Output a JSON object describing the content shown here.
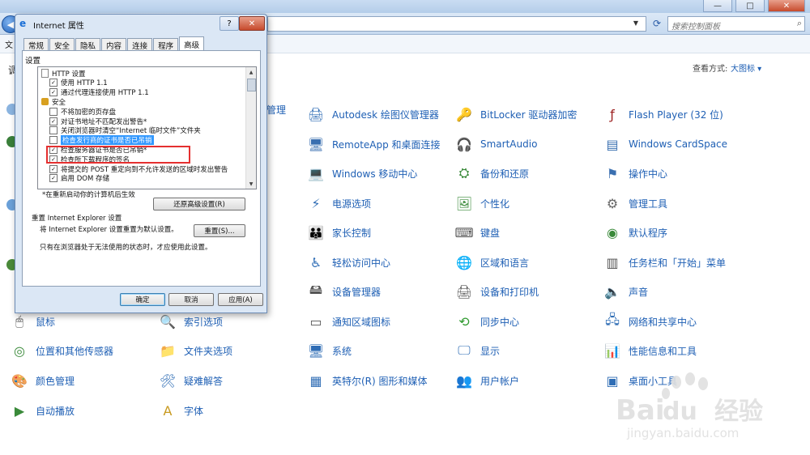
{
  "window": {
    "min": "—",
    "max": "□",
    "close": "✕",
    "menu_fragment": "文",
    "left_fragment": "调",
    "search_placeholder": "搜索控制面板",
    "view_by_label": "查看方式:",
    "view_by_value": "大图标 ▾",
    "partial_item": "管理"
  },
  "items": [
    {
      "label": "Autodesk 绘图仪管理器",
      "icon": "plotter-icon"
    },
    {
      "label": "BitLocker 驱动器加密",
      "icon": "bitlocker-icon"
    },
    {
      "label": "Flash Player (32 位)",
      "icon": "flash-icon"
    },
    {
      "label": "RemoteApp 和桌面连接",
      "icon": "remoteapp-icon"
    },
    {
      "label": "SmartAudio",
      "icon": "headphones-icon"
    },
    {
      "label": "Windows CardSpace",
      "icon": "cardspace-icon"
    },
    {
      "label": "Windows 移动中心",
      "icon": "mobility-icon"
    },
    {
      "label": "备份和还原",
      "icon": "backup-icon"
    },
    {
      "label": "操作中心",
      "icon": "flag-icon"
    },
    {
      "label": "电源选项",
      "icon": "power-icon"
    },
    {
      "label": "个性化",
      "icon": "personalize-icon"
    },
    {
      "label": "管理工具",
      "icon": "admin-tools-icon"
    },
    {
      "label": "家长控制",
      "icon": "parental-icon"
    },
    {
      "label": "键盘",
      "icon": "keyboard-icon"
    },
    {
      "label": "默认程序",
      "icon": "default-programs-icon"
    },
    {
      "label": "轻松访问中心",
      "icon": "ease-of-access-icon"
    },
    {
      "label": "区域和语言",
      "icon": "globe-icon"
    },
    {
      "label": "任务栏和「开始」菜单",
      "icon": "taskbar-icon"
    },
    {
      "label": "设备管理器",
      "icon": "device-manager-icon"
    },
    {
      "label": "设备和打印机",
      "icon": "printer-icon"
    },
    {
      "label": "声音",
      "icon": "sound-icon"
    },
    {
      "label": "鼠标",
      "icon": "mouse-icon"
    },
    {
      "label": "索引选项",
      "icon": "index-icon"
    },
    {
      "label": "通知区域图标",
      "icon": "notification-icon"
    },
    {
      "label": "同步中心",
      "icon": "sync-icon"
    },
    {
      "label": "网络和共享中心",
      "icon": "network-icon"
    },
    {
      "label": "位置和其他传感器",
      "icon": "sensor-icon"
    },
    {
      "label": "文件夹选项",
      "icon": "folder-icon"
    },
    {
      "label": "系统",
      "icon": "system-icon"
    },
    {
      "label": "显示",
      "icon": "display-icon"
    },
    {
      "label": "性能信息和工具",
      "icon": "performance-icon"
    },
    {
      "label": "颜色管理",
      "icon": "color-icon"
    },
    {
      "label": "疑难解答",
      "icon": "troubleshoot-icon"
    },
    {
      "label": "英特尔(R) 图形和媒体",
      "icon": "intel-graphics-icon"
    },
    {
      "label": "用户帐户",
      "icon": "users-icon"
    },
    {
      "label": "桌面小工具",
      "icon": "gadgets-icon"
    },
    {
      "label": "自动播放",
      "icon": "autoplay-icon"
    },
    {
      "label": "字体",
      "icon": "font-icon"
    }
  ],
  "dialog": {
    "title": "Internet 属性",
    "help": "?",
    "close": "✕",
    "tabs": [
      "常规",
      "安全",
      "隐私",
      "内容",
      "连接",
      "程序",
      "高级"
    ],
    "settings_label": "设置",
    "tree": [
      {
        "type": "doc",
        "text": "HTTP 设置"
      },
      {
        "type": "cb",
        "checked": true,
        "text": "使用 HTTP 1.1"
      },
      {
        "type": "cb",
        "checked": true,
        "text": "通过代理连接使用 HTTP 1.1"
      },
      {
        "type": "lock",
        "text": "安全"
      },
      {
        "type": "cb",
        "checked": false,
        "text": "不将加密的页存盘"
      },
      {
        "type": "cb",
        "checked": true,
        "text": "对证书地址不匹配发出警告*"
      },
      {
        "type": "cb",
        "checked": false,
        "text": "关闭浏览器时清空“Internet 临时文件”文件夹"
      },
      {
        "type": "cb",
        "checked": false,
        "text": "检查发行商的证书是否已吊销",
        "selected": true
      },
      {
        "type": "cb",
        "checked": true,
        "text": "检查服务器证书是否已吊销*"
      },
      {
        "type": "cb",
        "checked": true,
        "text": "检查所下载程序的签名"
      },
      {
        "type": "cb",
        "checked": true,
        "text": "将提交的 POST 重定向到不允许发送的区域时发出警告"
      },
      {
        "type": "cb",
        "checked": true,
        "text": "启用 DOM 存储"
      }
    ],
    "restart_note": "*在重新启动你的计算机后生效",
    "restore_btn": "还原高级设置(R)",
    "reset_group": "重置 Internet Explorer 设置",
    "reset_desc": "将 Internet Explorer 设置重置为默认设置。",
    "reset_btn": "重置(S)...",
    "reset_note": "只有在浏览器处于无法使用的状态时，才应使用此设置。",
    "ok": "确定",
    "cancel": "取消",
    "apply": "应用(A)"
  },
  "watermark": {
    "brand": "Bai",
    "brand2": "du",
    "cn": "经验",
    "url": "jingyan.baidu.com"
  }
}
